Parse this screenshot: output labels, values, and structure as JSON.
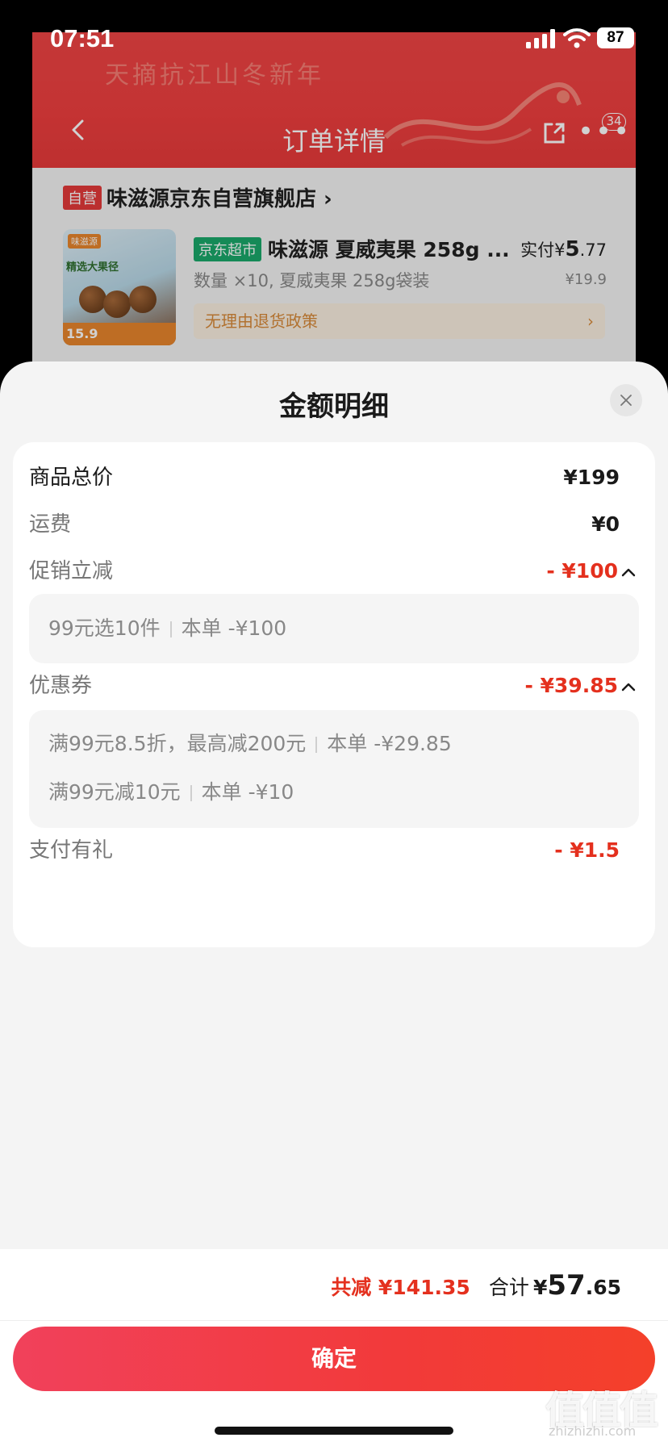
{
  "status_bar": {
    "time": "07:51",
    "battery": "87"
  },
  "background_page": {
    "title": "订单详情",
    "more_badge": "34",
    "self_operated_tag": "自营",
    "store_name": "味滋源京东自营旗舰店 ›",
    "product": {
      "channel_tag": "京东超市",
      "name": "味滋源 夏威夷果 258g ...",
      "paid_prefix": "实付",
      "paid_currency": "¥",
      "paid_int": "5",
      "paid_dec": ".77",
      "quantity_spec": "数量 ×10, 夏威夷果 258g袋装",
      "unit_price": "¥19.9",
      "policy": "无理由退货政策",
      "policy_arrow": "›",
      "thumb_brand": "味滋源",
      "thumb_slogan": "精选大果径",
      "thumb_price": "15.9"
    },
    "banner_faint_text": "天摘抗江山冬新年"
  },
  "sheet": {
    "title": "金额明细",
    "rows": {
      "goods_total": {
        "label": "商品总价",
        "value": "¥199"
      },
      "shipping": {
        "label": "运费",
        "value": "¥0"
      },
      "promo": {
        "label": "促销立减",
        "value": "- ¥100"
      },
      "coupon": {
        "label": "优惠券",
        "value": "- ¥39.85"
      },
      "pay_gift": {
        "label": "支付有礼",
        "value": "- ¥1.5"
      }
    },
    "promo_details": [
      {
        "rule": "99元选10件",
        "amount": "本单 -¥100"
      }
    ],
    "coupon_details": [
      {
        "rule": "满99元8.5折，最高减200元",
        "amount": "本单 -¥29.85"
      },
      {
        "rule": "满99元减10元",
        "amount": "本单 -¥10"
      }
    ]
  },
  "footer": {
    "saved": "共减 ¥141.35",
    "total_label": "合计",
    "total_currency": "¥",
    "total_int": "57",
    "total_dec": ".65",
    "confirm_label": "确定"
  },
  "watermark": {
    "big": "值值值",
    "small": "zhizhizhi.com"
  },
  "colors": {
    "accent_red": "#e4301e",
    "button_gradient_start": "#f1415b",
    "button_gradient_end": "#f4402a"
  }
}
